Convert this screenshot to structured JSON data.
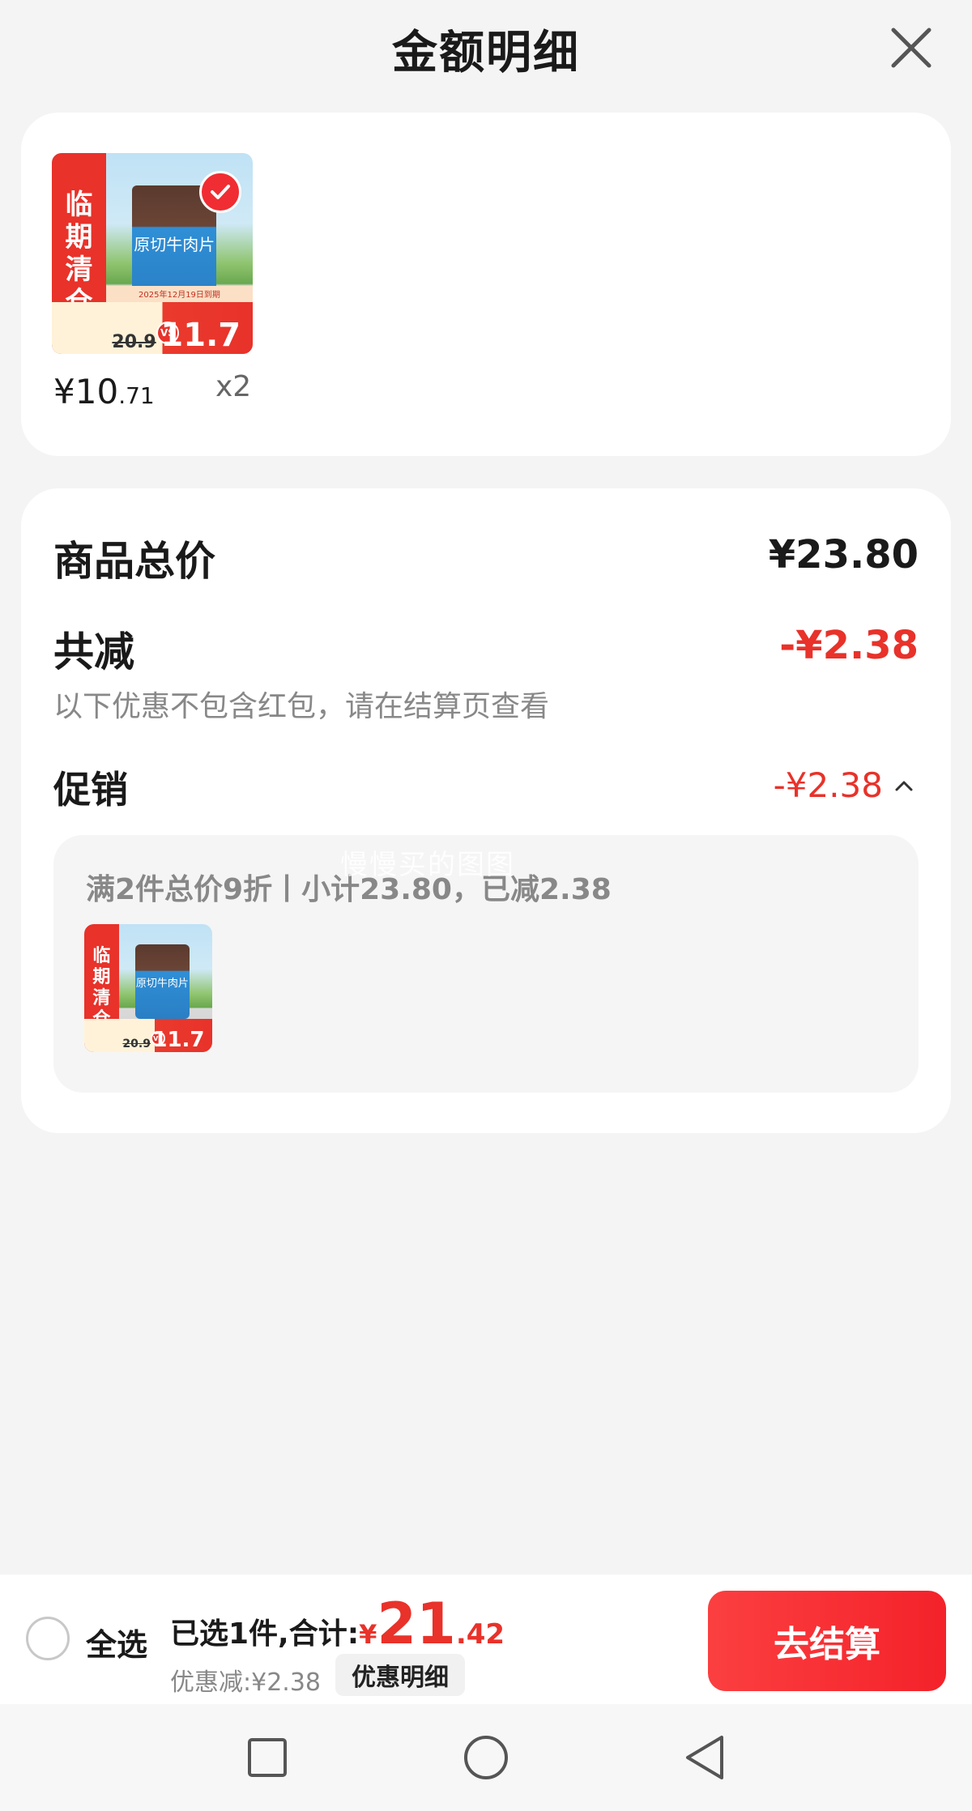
{
  "header": {
    "title": "金额明细"
  },
  "product": {
    "unit_price_symbol": "¥",
    "unit_price_int": "10",
    "unit_price_dec": ".71",
    "quantity": "x2",
    "image": {
      "tag_chars": [
        "临",
        "期",
        "清",
        "仓"
      ],
      "pack_text": "原切牛肉片",
      "old_price": "20.9",
      "new_price": "11.7",
      "vs": "VS",
      "promo_line": "2025年12月19日到期"
    }
  },
  "summary": {
    "total_label": "商品总价",
    "total_value": "¥23.80",
    "reduction_label": "共减",
    "reduction_value": "-¥2.38",
    "reduction_note": "以下优惠不包含红包，请在结算页查看",
    "promo_label": "促销",
    "promo_value": "-¥2.38",
    "promo_desc": "满2件总价9折丨小计23.80，已减2.38",
    "watermark": "慢慢买的图图"
  },
  "bottom": {
    "select_all": "全选",
    "selected_text": "已选1件,合计:",
    "currency": "¥",
    "total_int": "21",
    "total_dec": ".42",
    "discount_text": "优惠减:¥2.38",
    "discount_detail_button": "优惠明细",
    "checkout_button": "去结算"
  },
  "colors": {
    "accent_red": "#e8322a",
    "checkout_red": "#f4222a"
  },
  "icons": [
    "close-icon",
    "check-icon",
    "chevron-up-icon",
    "square-nav-icon",
    "circle-nav-icon",
    "back-triangle-nav-icon"
  ]
}
